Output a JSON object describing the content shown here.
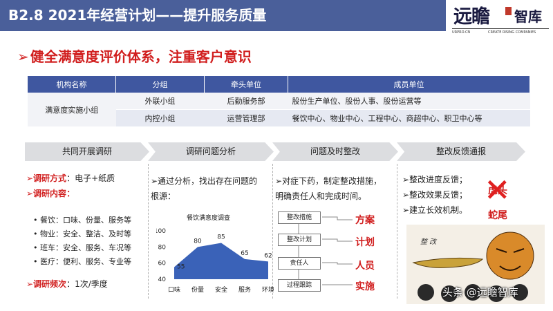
{
  "header": {
    "title": "B2.8  2021年经营计划——提升服务质量",
    "logo_brush": "远瞻",
    "logo_cn": "智库",
    "logo_url": "URPRO.CN",
    "logo_tagline": "CREATE RISING COMPANIES"
  },
  "headline": {
    "arrow": "➢",
    "text": "健全满意度评价体系，注重客户意识"
  },
  "table": {
    "headers": [
      "机构名称",
      "分组",
      "牵头单位",
      "成员单位"
    ],
    "group_name": "满意度实施小组",
    "rows": [
      {
        "group": "外联小组",
        "lead": "后勤服务部",
        "members": "股份生产单位、股份人事、股份运营等"
      },
      {
        "group": "内控小组",
        "lead": "运营管理部",
        "members": "餐饮中心、物业中心、工程中心、商超中心、职卫中心等"
      }
    ]
  },
  "steps": [
    "共同开展调研",
    "调研问题分析",
    "问题及时整改",
    "整改反馈通报"
  ],
  "col1": {
    "method_label": "➢调研方式",
    "method_value": "：电子+纸质",
    "content_label": "➢调研内容",
    "content_colon": "：",
    "items": [
      "餐饮：口味、份量、服务等",
      "物业：安全、整洁、及时等",
      "班车：安全、服务、车况等",
      "医疗：便利、服务、专业等"
    ],
    "bullet": "•",
    "freq_label": "➢调研频次",
    "freq_value": "：1次/季度"
  },
  "col2": {
    "line1": "➢通过分析，找出存在问题的",
    "line2": "根源："
  },
  "chart_data": {
    "type": "area",
    "title": "餐饮满意度调查",
    "categories": [
      "口味",
      "份量",
      "安全",
      "服务",
      "环境"
    ],
    "values": [
      55,
      80,
      85,
      65,
      62
    ],
    "ylim": [
      40,
      100
    ],
    "yticks": [
      40,
      60,
      80,
      100
    ],
    "color": "#3a62b8"
  },
  "col3": {
    "line1": "➢对症下药，制定整改措施，",
    "line2": "明确责任人和完成时间。",
    "flow": [
      "整改措施",
      "整改计划",
      "责任人",
      "过程跟踪"
    ],
    "labels": [
      "方案",
      "计划",
      "人员",
      "实施"
    ]
  },
  "col4": {
    "items": [
      "➢整改进度反馈；",
      "➢整改效果反馈；",
      "➢建立长效机制。"
    ],
    "stamp_text": "虎头蛇尾",
    "cross": "✕",
    "cartoon_caption": "整  改"
  },
  "watermark": "头条 @远瞻智库",
  "colors": {
    "header": "#4a5f9a",
    "accent_red": "#d11f1f",
    "table_header": "#3f57a0"
  }
}
